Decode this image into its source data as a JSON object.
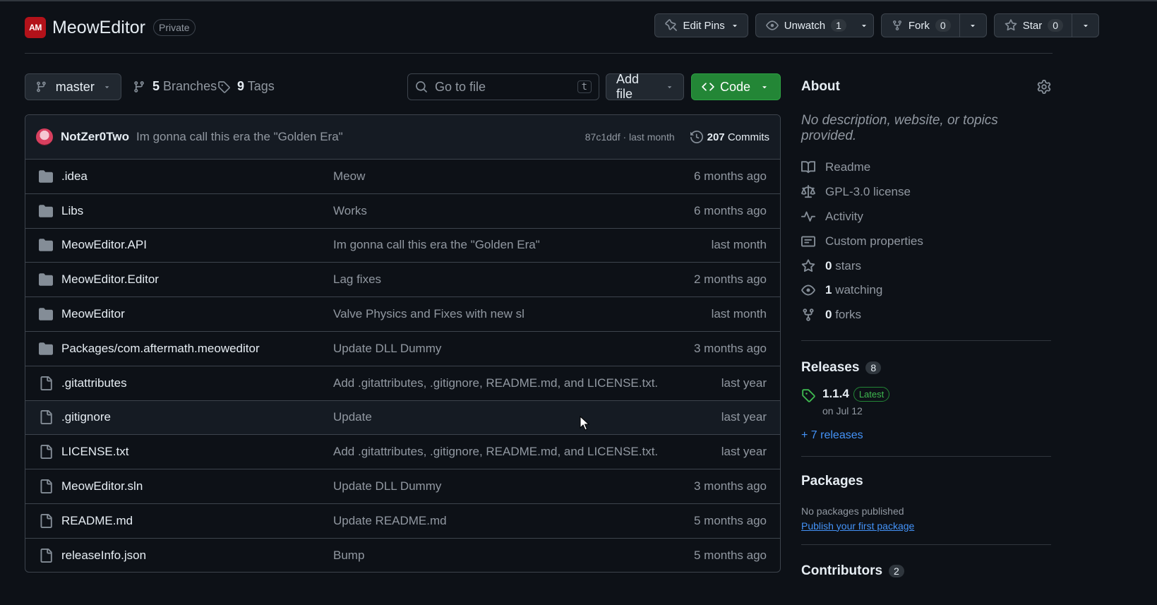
{
  "repo": {
    "logo_text": "AM",
    "name": "MeowEditor",
    "visibility": "Private"
  },
  "header_actions": {
    "edit_pins": "Edit Pins",
    "unwatch": "Unwatch",
    "unwatch_count": "1",
    "fork": "Fork",
    "fork_count": "0",
    "star": "Star",
    "star_count": "0"
  },
  "toolbar": {
    "branch": "master",
    "branches_count": "5",
    "branches_label": "Branches",
    "tags_count": "9",
    "tags_label": "Tags",
    "search_placeholder": "Go to file",
    "search_shortcut": "t",
    "add_file": "Add file",
    "code": "Code"
  },
  "latest_commit": {
    "author": "NotZer0Two",
    "message": "Im gonna call this era the \"Golden Era\"",
    "hash_time": "87c1ddf · last month",
    "commits_count": "207",
    "commits_label": "Commits"
  },
  "files": [
    {
      "type": "dir",
      "name": ".idea",
      "message": "Meow",
      "date": "6 months ago"
    },
    {
      "type": "dir",
      "name": "Libs",
      "message": "Works",
      "date": "6 months ago"
    },
    {
      "type": "dir",
      "name": "MeowEditor.API",
      "message": "Im gonna call this era the \"Golden Era\"",
      "date": "last month"
    },
    {
      "type": "dir",
      "name": "MeowEditor.Editor",
      "message": "Lag fixes",
      "date": "2 months ago"
    },
    {
      "type": "dir",
      "name": "MeowEditor",
      "message": "Valve Physics and Fixes with new sl",
      "date": "last month"
    },
    {
      "type": "dir",
      "name": "Packages/com.aftermath.meoweditor",
      "message": "Update DLL Dummy",
      "date": "3 months ago"
    },
    {
      "type": "file",
      "name": ".gitattributes",
      "message": "Add .gitattributes, .gitignore, README.md, and LICENSE.txt.",
      "date": "last year"
    },
    {
      "type": "file",
      "name": ".gitignore",
      "message": "Update",
      "date": "last year"
    },
    {
      "type": "file",
      "name": "LICENSE.txt",
      "message": "Add .gitattributes, .gitignore, README.md, and LICENSE.txt.",
      "date": "last year"
    },
    {
      "type": "file",
      "name": "MeowEditor.sln",
      "message": "Update DLL Dummy",
      "date": "3 months ago"
    },
    {
      "type": "file",
      "name": "README.md",
      "message": "Update README.md",
      "date": "5 months ago"
    },
    {
      "type": "file",
      "name": "releaseInfo.json",
      "message": "Bump",
      "date": "5 months ago"
    }
  ],
  "about": {
    "title": "About",
    "description": "No description, website, or topics provided.",
    "readme": "Readme",
    "license": "GPL-3.0 license",
    "activity": "Activity",
    "custom_properties": "Custom properties",
    "stars_count": "0",
    "stars_label": "stars",
    "watching_count": "1",
    "watching_label": "watching",
    "forks_count": "0",
    "forks_label": "forks"
  },
  "releases": {
    "title": "Releases",
    "count": "8",
    "latest_version": "1.1.4",
    "latest_badge": "Latest",
    "latest_date": "on Jul 12",
    "more_link": "+ 7 releases"
  },
  "packages": {
    "title": "Packages",
    "none_text": "No packages published",
    "publish_link": "Publish your first package"
  },
  "contributors": {
    "title": "Contributors",
    "count": "2"
  }
}
